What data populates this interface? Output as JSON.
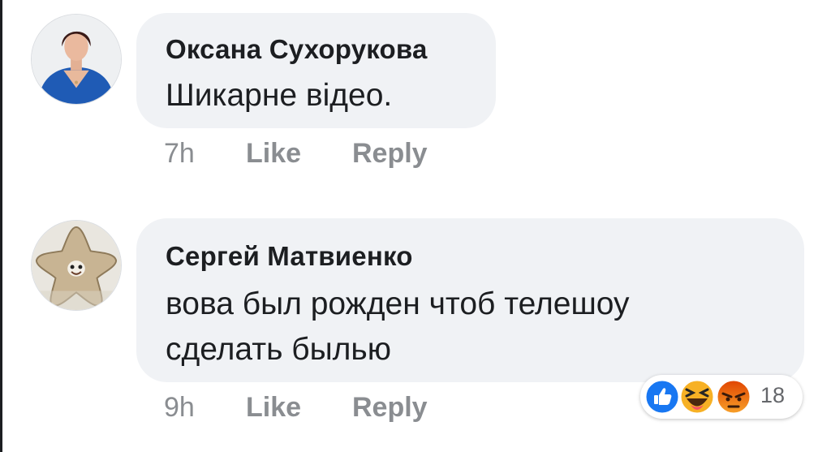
{
  "comments": [
    {
      "author": "Оксана Сухорукова",
      "text_lines": [
        "Шикарне відео."
      ],
      "time": "7h",
      "like_label": "Like",
      "reply_label": "Reply"
    },
    {
      "author": "Сергей Матвиенко",
      "text_lines": [
        "вова был рожден чтоб телешоу",
        "сделать былью"
      ],
      "time": "9h",
      "like_label": "Like",
      "reply_label": "Reply",
      "reactions": {
        "icons": [
          "like-icon",
          "haha-icon",
          "angry-icon"
        ],
        "count": "18"
      }
    }
  ],
  "colors": {
    "bubble": "#f0f2f5",
    "text": "#1c1e21",
    "meta": "#8a8d91",
    "like_blue": "#1877f2",
    "haha_yellow": "#f7b125",
    "angry_orange": "#e9710f"
  }
}
